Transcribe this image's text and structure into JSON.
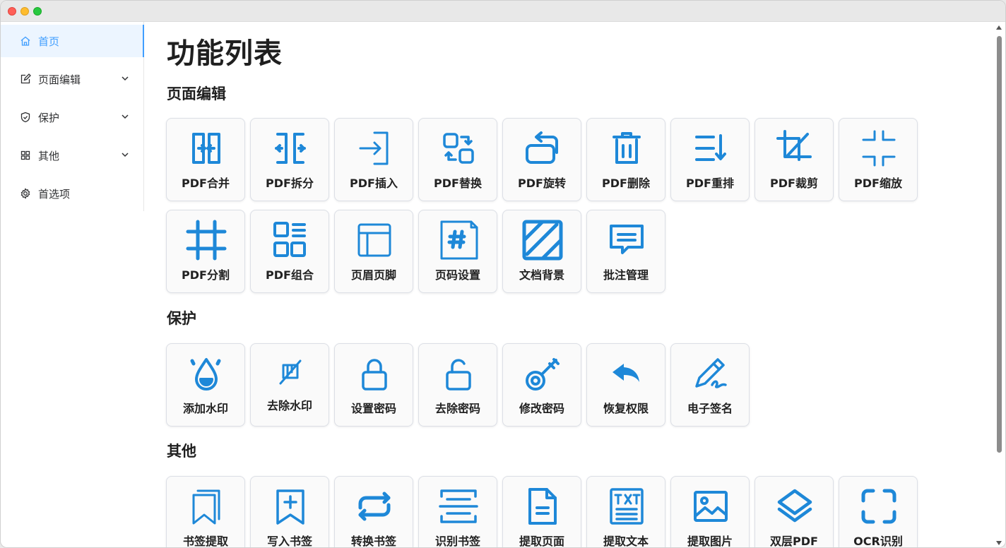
{
  "sidebar": {
    "items": [
      {
        "label": "首页",
        "icon": "home-icon",
        "active": true
      },
      {
        "label": "页面编辑",
        "icon": "edit-icon"
      },
      {
        "label": "保护",
        "icon": "shield-icon"
      },
      {
        "label": "其他",
        "icon": "grid-icon"
      },
      {
        "label": "首选项",
        "icon": "gear-icon"
      }
    ]
  },
  "main": {
    "title": "功能列表",
    "sections": [
      {
        "title": "页面编辑",
        "items": [
          {
            "label": "PDF合并",
            "icon": "merge-icon"
          },
          {
            "label": "PDF拆分",
            "icon": "split-icon"
          },
          {
            "label": "PDF插入",
            "icon": "insert-icon"
          },
          {
            "label": "PDF替换",
            "icon": "replace-icon"
          },
          {
            "label": "PDF旋转",
            "icon": "rotate-icon"
          },
          {
            "label": "PDF删除",
            "icon": "trash-icon"
          },
          {
            "label": "PDF重排",
            "icon": "reorder-icon"
          },
          {
            "label": "PDF裁剪",
            "icon": "crop-icon"
          },
          {
            "label": "PDF缩放",
            "icon": "shrink-icon"
          },
          {
            "label": "PDF分割",
            "icon": "cut-icon"
          },
          {
            "label": "PDF组合",
            "icon": "combine-icon"
          },
          {
            "label": "页眉页脚",
            "icon": "header-footer-icon"
          },
          {
            "label": "页码设置",
            "icon": "page-number-icon"
          },
          {
            "label": "文档背景",
            "icon": "background-icon"
          },
          {
            "label": "批注管理",
            "icon": "comment-icon"
          }
        ]
      },
      {
        "title": "保护",
        "items": [
          {
            "label": "添加水印",
            "icon": "watermark-icon"
          },
          {
            "label": "去除水印",
            "icon": "remove-watermark-icon"
          },
          {
            "label": "设置密码",
            "icon": "lock-icon"
          },
          {
            "label": "去除密码",
            "icon": "unlock-icon"
          },
          {
            "label": "修改密码",
            "icon": "key-icon"
          },
          {
            "label": "恢复权限",
            "icon": "undo-icon"
          },
          {
            "label": "电子签名",
            "icon": "signature-icon"
          }
        ]
      },
      {
        "title": "其他",
        "items": [
          {
            "label": "书签提取",
            "icon": "bookmarks-icon"
          },
          {
            "label": "写入书签",
            "icon": "add-bookmark-icon"
          },
          {
            "label": "转换书签",
            "icon": "convert-icon"
          },
          {
            "label": "识别书签",
            "icon": "scan-icon"
          },
          {
            "label": "提取页面",
            "icon": "document-icon"
          },
          {
            "label": "提取文本",
            "icon": "txt-icon"
          },
          {
            "label": "提取图片",
            "icon": "image-icon"
          },
          {
            "label": "双层PDF",
            "icon": "layers-icon"
          },
          {
            "label": "OCR识别",
            "icon": "ocr-icon"
          }
        ]
      }
    ]
  },
  "colors": {
    "accent": "#409eff",
    "icon": "#1e88d8"
  }
}
